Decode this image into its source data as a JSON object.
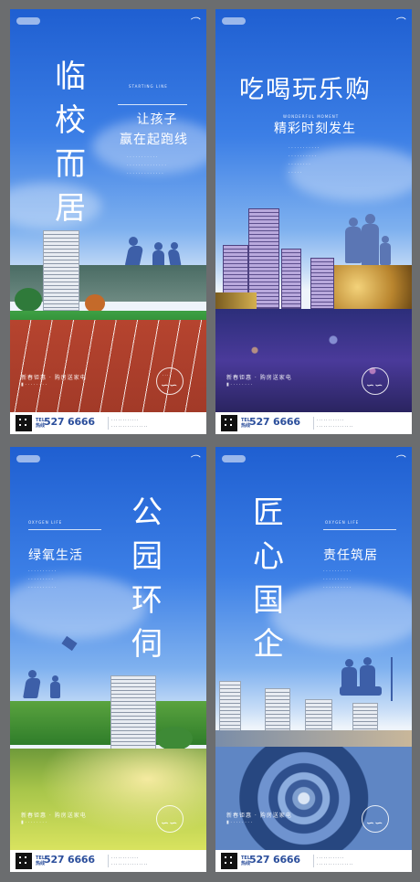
{
  "posters": [
    {
      "title": [
        "临",
        "校",
        "而",
        "居"
      ],
      "subtitle": [
        "让孩子",
        "赢在起跑线"
      ],
      "slogan": "新春钜惠 · 购房送家电",
      "tagline": "STARTING LINE"
    },
    {
      "title": "吃喝玩乐购",
      "subtitle": "精彩时刻发生",
      "slogan": "新春钜惠 · 购房送家电",
      "tagline": "WONDERFUL MOMENT"
    },
    {
      "title": [
        "公",
        "园",
        "环",
        "伺"
      ],
      "subtitle": "绿氧生活",
      "slogan": "新春钜惠 · 购房送家电",
      "tagline": "OXYGEN LIFE"
    },
    {
      "title": [
        "匠",
        "心",
        "国",
        "企"
      ],
      "subtitle": "责任筑居",
      "slogan": "新春钜惠 · 购房送家电",
      "tagline": "OXYGEN LIFE"
    }
  ],
  "footer": {
    "phone": "527 6666",
    "tel_label": "TEL",
    "tel_label_cn": "热线"
  },
  "colors": {
    "sky_top": "#1f5fd1",
    "sky_mid": "#7fb1ef",
    "brand_blue": "#2c4f9c",
    "frame": "#6b6d6f"
  }
}
